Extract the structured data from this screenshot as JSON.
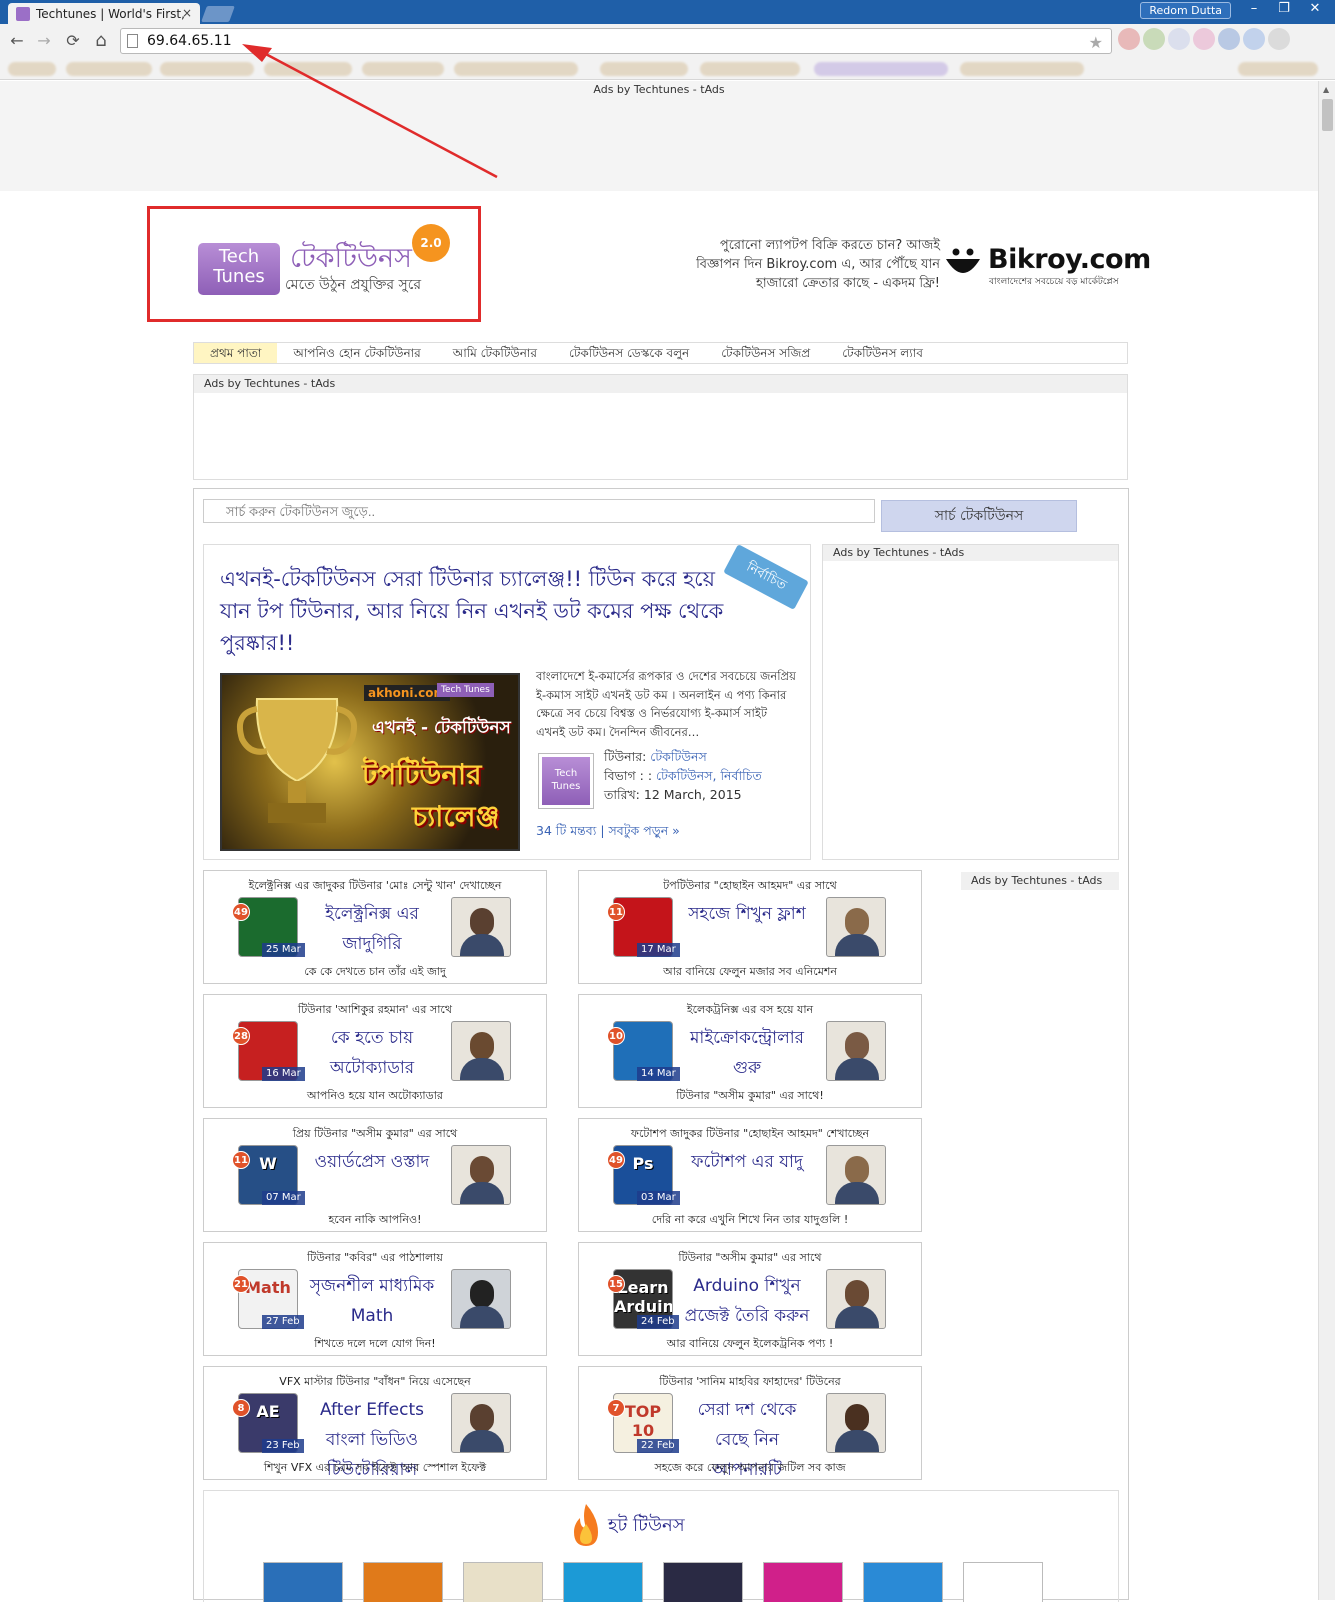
{
  "browser": {
    "tab_title": "Techtunes | World's First,",
    "tab_close": "×",
    "user_name": "Redom Dutta",
    "minimize": "–",
    "restore": "❐",
    "close": "✕",
    "url": "69.64.65.11",
    "back": "←",
    "forward": "→",
    "reload": "⟳",
    "home": "⌂",
    "star": "★"
  },
  "ads": {
    "top_label": "Ads by Techtunes - tAds",
    "block_label": "Ads by Techtunes - tAds",
    "side_label_1": "Ads by Techtunes - tAds",
    "side_label_2": "Ads by Techtunes - tAds"
  },
  "logo": {
    "tile_line1": "Tech",
    "tile_line2": "Tunes",
    "text": "টেকটিউনস",
    "tagline": "মেতে উঠুন প্রযুক্তির সুরে",
    "badge": "2.0"
  },
  "bikroy": {
    "ad_text": "পুরোনো ল্যাপটপ বিক্রি করতে চান? আজই বিজ্ঞাপন দিন Bikroy.com এ, আর পৌঁছে যান হাজারো ক্রেতার কাছে - একদম ফ্রি!",
    "logo": "Bikroy.com",
    "tagline": "বাংলাদেশের সবচেয়ে বড় মার্কেটপ্লেস"
  },
  "nav": [
    {
      "label": "প্রথম পাতা"
    },
    {
      "label": "আপনিও হোন টেকটিউনার"
    },
    {
      "label": "আমি টেকটিউনার"
    },
    {
      "label": "টেকটিউনস ডেস্ককে বলুন"
    },
    {
      "label": "টেকটিউনস সজিপ্র"
    },
    {
      "label": "টেকটিউনস ল্যাব"
    }
  ],
  "search": {
    "placeholder": "সার্চ করুন টেকটিউনস জুড়ে..",
    "button": "সার্চ টেকটিউনস"
  },
  "featured": {
    "title": "এখনই-টেকটিউনস সেরা টিউনার চ্যালেঞ্জ!! টিউন করে হয়ে যান টপ টিউনার, আর নিয়ে নিন এখনই ডট কমের পক্ষ থেকে পুরষ্কার!!",
    "ribbon": "নির্বাচিত",
    "image_brand": "akhoni.com",
    "image_brand2": "Tech Tunes",
    "image_line1": "এখনই - টেকটিউনস",
    "image_line2": "টপটিউনার",
    "image_line3": "চ্যালেঞ্জ",
    "excerpt": "বাংলাদেশে ই-কমার্সের রূপকার ও দেশের সবচেয়ে জনপ্রিয় ই-কমাস সাইট এখনই ডট কম । অনলাইন এ পণ্য কিনার ক্ষেত্রে সব চেয়ে বিশ্বস্ত ও নির্ভরযোগ্য ই-কমার্স সাইট এখনই ডট কম। দৈনন্দিন জীবনের…",
    "avatar_text": "Tech Tunes",
    "tuner_label": "টিউনার:",
    "tuner_name": "টেকটিউনস",
    "category_label": "বিভাগ : :",
    "category_value": "টেকটিউনস, নির্বাচিত",
    "date_label": "তারিখ:",
    "date_value": "12 March, 2015",
    "comments": "34 টি মন্তব্য | সবটুক পড়ুন »"
  },
  "cards": [
    {
      "header": "ইলেক্ট্রনিক্স এর জাদুকর টিউনার 'মোঃ সেন্টু খান' দেখাচ্ছেন",
      "count": "49",
      "date": "25 Mar",
      "title": "ইলেক্ট্রনিক্স এর জাদুগিরি",
      "footer": "কে কে দেখতে চান তাঁর এই জাদু",
      "thumb_color": "#1b6b2e"
    },
    {
      "header": "টপটিউনার \"হোছাইন আহমদ\" এর সাথে",
      "count": "11",
      "date": "17 Mar",
      "title": "সহজে শিখুন ফ্লাশ",
      "footer": "আর বানিয়ে ফেলুন মজার সব এনিমেশন",
      "thumb_color": "#c4141a"
    },
    {
      "header": "টিউনার 'আশিকুর রহমান' এর সাথে",
      "count": "28",
      "date": "16 Mar",
      "title": "কে হতে চায় অটোক্যাডার",
      "footer": "আপনিও হয়ে যান অটোক্যাডার",
      "thumb_color": "#c62020"
    },
    {
      "header": "ইলেকট্রনিক্স এর বস হয়ে যান",
      "count": "10",
      "date": "14 Mar",
      "title": "মাইক্রোকন্ট্রোলার গুরু",
      "footer": "টিউনার \"অসীম কুমার\" এর সাথে!",
      "thumb_color": "#1f6fb8"
    },
    {
      "header": "প্রিয় টিউনার \"অসীম কুমার\" এর সাথে",
      "count": "11",
      "date": "07 Mar",
      "title": "ওয়ার্ডপ্রেস ওস্তাদ",
      "footer": "হবেন নাকি আপনিও!",
      "thumb_color": "#264f86"
    },
    {
      "header": "ফটোশপ জাদুকর টিউনার \"হোছাইন আহমদ\" শেখাচ্ছেন",
      "count": "49",
      "date": "03 Mar",
      "title": "ফটোশপ এর যাদু",
      "footer": "দেরি না করে এখুনি শিখে নিন তার যাদুগুলি !",
      "thumb_color": "#1a4f9a"
    },
    {
      "header": "টিউনার \"কবির\" এর পাঠশালায়",
      "count": "21",
      "date": "27 Feb",
      "title": "সৃজনশীল মাধ্যমিক Math",
      "footer": "শিখতে দলে দলে যোগ দিন!",
      "thumb_color": "#f2f2f2"
    },
    {
      "header": "টিউনার \"অসীম কুমার\" এর সাথে",
      "count": "15",
      "date": "24 Feb",
      "title": "Arduino শিখুন প্রজেক্ট তৈরি করুন",
      "footer": "আর বানিয়ে ফেলুন ইলেকট্রনিক পণ্য !",
      "thumb_color": "#333333"
    },
    {
      "header": "VFX মাস্টার টিউনার \"বাঁধন\" নিয়ে এসেছেন",
      "count": "8",
      "date": "23 Feb",
      "title": "After Effects বাংলা ভিডিও টিউটোরিয়াল",
      "footer": "শিখুন VFX এর চরম সব ইফেক্ট আর স্পেশাল ইফেক্ট",
      "thumb_color": "#3a3a6a"
    },
    {
      "header": "টিউনার 'সানিম মাহবির ফাহাদের' টিউনের",
      "count": "7",
      "date": "22 Feb",
      "title": "সেরা দশ থেকে বেছে নিন আপনারটি",
      "footer": "সহজে করে ফেলুন আপনার জটিল সব কাজ",
      "thumb_color": "#f5f0e0"
    }
  ],
  "card_icons": [
    "chip-icon",
    "flash-icon",
    "autocad-icon",
    "microcontroller-icon",
    "wordpress-icon",
    "photoshop-icon",
    "math-icon",
    "arduino-icon",
    "after-effects-icon",
    "top-ten-icon"
  ],
  "card_thumb_labels": [
    "",
    "",
    "",
    "",
    "W",
    "Ps",
    "Math",
    "Learn Arduino",
    "AE",
    "TOP 10"
  ],
  "hot": {
    "title": "হট টিউনস",
    "thumbs": [
      "#2a6fb8",
      "#e07a1a",
      "#e8e0c8",
      "#1c9ad6",
      "#2a2a44",
      "#d0208a",
      "#2a8ad6",
      "#ffffff"
    ]
  },
  "colors": {
    "accent": "#8e5fb7",
    "link": "#3a63b5",
    "title_blue": "#2a2a8a",
    "highlight_red": "#e02b2b"
  }
}
